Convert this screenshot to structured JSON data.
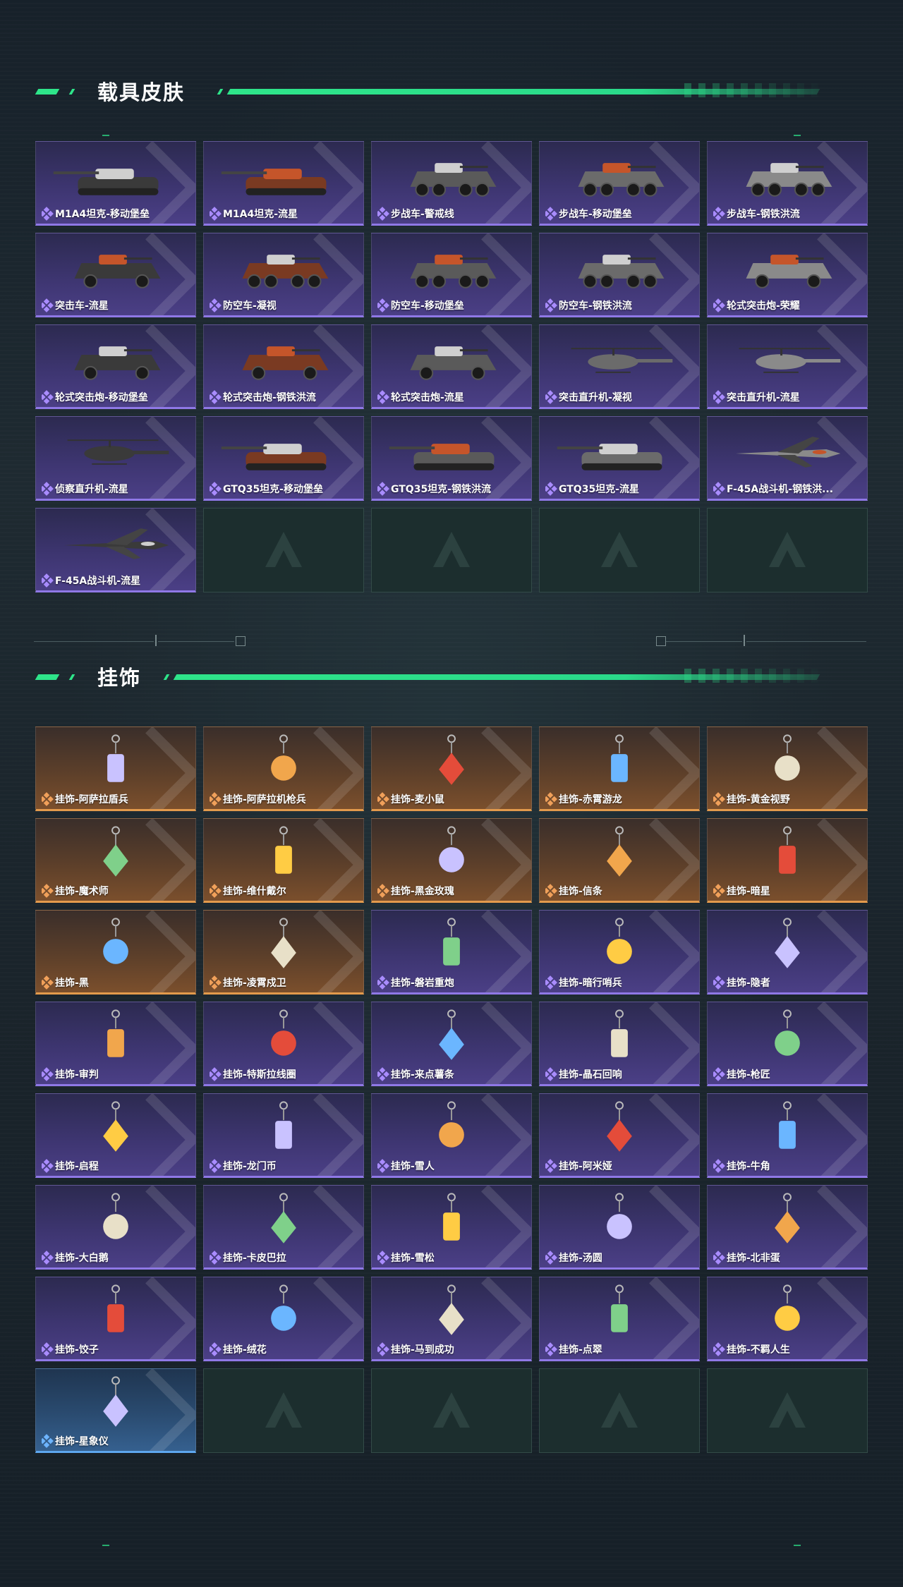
{
  "sections": [
    {
      "title": "载具皮肤"
    },
    {
      "title": "挂饰"
    }
  ],
  "colors": {
    "accent": "#2ee58a",
    "purple": "#8f78e6",
    "orange": "#e39a4c",
    "blue": "#5ea8f0"
  },
  "vehicles": [
    {
      "name": "M1A4坦克-移动堡垒",
      "rarity": "purple",
      "kind": "tank-icon"
    },
    {
      "name": "M1A4坦克-流星",
      "rarity": "purple",
      "kind": "tank-icon"
    },
    {
      "name": "步战车-警戒线",
      "rarity": "purple",
      "kind": "ifv-icon"
    },
    {
      "name": "步战车-移动堡垒",
      "rarity": "purple",
      "kind": "ifv-icon"
    },
    {
      "name": "步战车-钢铁洪流",
      "rarity": "purple",
      "kind": "ifv-icon"
    },
    {
      "name": "突击车-流星",
      "rarity": "purple",
      "kind": "assault-vehicle-icon"
    },
    {
      "name": "防空车-凝视",
      "rarity": "purple",
      "kind": "ifv-icon"
    },
    {
      "name": "防空车-移动堡垒",
      "rarity": "purple",
      "kind": "ifv-icon"
    },
    {
      "name": "防空车-钢铁洪流",
      "rarity": "purple",
      "kind": "ifv-icon"
    },
    {
      "name": "轮式突击炮-荣耀",
      "rarity": "purple",
      "kind": "wheeled-gun-icon"
    },
    {
      "name": "轮式突击炮-移动堡垒",
      "rarity": "purple",
      "kind": "wheeled-gun-icon"
    },
    {
      "name": "轮式突击炮-钢铁洪流",
      "rarity": "purple",
      "kind": "wheeled-gun-icon"
    },
    {
      "name": "轮式突击炮-流星",
      "rarity": "purple",
      "kind": "wheeled-gun-icon"
    },
    {
      "name": "突击直升机-凝视",
      "rarity": "purple",
      "kind": "helicopter-icon"
    },
    {
      "name": "突击直升机-流星",
      "rarity": "purple",
      "kind": "helicopter-icon"
    },
    {
      "name": "侦察直升机-流星",
      "rarity": "purple",
      "kind": "helicopter-icon"
    },
    {
      "name": "GTQ35坦克-移动堡垒",
      "rarity": "purple",
      "kind": "tank-icon"
    },
    {
      "name": "GTQ35坦克-钢铁洪流",
      "rarity": "purple",
      "kind": "tank-icon"
    },
    {
      "name": "GTQ35坦克-流星",
      "rarity": "purple",
      "kind": "tank-icon"
    },
    {
      "name": "F-45A战斗机-钢铁洪...",
      "rarity": "purple",
      "kind": "jet-icon"
    },
    {
      "name": "F-45A战斗机-流星",
      "rarity": "purple",
      "kind": "jet-icon"
    }
  ],
  "charms": [
    {
      "name": "挂饰-阿萨拉盾兵",
      "rarity": "orange"
    },
    {
      "name": "挂饰-阿萨拉机枪兵",
      "rarity": "orange"
    },
    {
      "name": "挂饰-麦小鼠",
      "rarity": "orange"
    },
    {
      "name": "挂饰-赤霄游龙",
      "rarity": "orange"
    },
    {
      "name": "挂饰-黄金视野",
      "rarity": "orange"
    },
    {
      "name": "挂饰-魔术师",
      "rarity": "orange"
    },
    {
      "name": "挂饰-维什戴尔",
      "rarity": "orange"
    },
    {
      "name": "挂饰-黑金玫瑰",
      "rarity": "orange"
    },
    {
      "name": "挂饰-信条",
      "rarity": "orange"
    },
    {
      "name": "挂饰-暗星",
      "rarity": "orange"
    },
    {
      "name": "挂饰-黑",
      "rarity": "orange"
    },
    {
      "name": "挂饰-凌霄戍卫",
      "rarity": "orange"
    },
    {
      "name": "挂饰-磐岩重炮",
      "rarity": "purple"
    },
    {
      "name": "挂饰-暗行哨兵",
      "rarity": "purple"
    },
    {
      "name": "挂饰-隐者",
      "rarity": "purple"
    },
    {
      "name": "挂饰-审判",
      "rarity": "purple"
    },
    {
      "name": "挂饰-特斯拉线圈",
      "rarity": "purple"
    },
    {
      "name": "挂饰-来点薯条",
      "rarity": "purple"
    },
    {
      "name": "挂饰-晶石回响",
      "rarity": "purple"
    },
    {
      "name": "挂饰-枪匠",
      "rarity": "purple"
    },
    {
      "name": "挂饰-启程",
      "rarity": "purple"
    },
    {
      "name": "挂饰-龙门币",
      "rarity": "purple"
    },
    {
      "name": "挂饰-雪人",
      "rarity": "purple"
    },
    {
      "name": "挂饰-阿米娅",
      "rarity": "purple"
    },
    {
      "name": "挂饰-牛角",
      "rarity": "purple"
    },
    {
      "name": "挂饰-大白鹅",
      "rarity": "purple"
    },
    {
      "name": "挂饰-卡皮巴拉",
      "rarity": "purple"
    },
    {
      "name": "挂饰-雪松",
      "rarity": "purple"
    },
    {
      "name": "挂饰-汤圆",
      "rarity": "purple"
    },
    {
      "name": "挂饰-北非蛋",
      "rarity": "purple"
    },
    {
      "name": "挂饰-饺子",
      "rarity": "purple"
    },
    {
      "name": "挂饰-绒花",
      "rarity": "purple"
    },
    {
      "name": "挂饰-马到成功",
      "rarity": "purple"
    },
    {
      "name": "挂饰-点翠",
      "rarity": "purple"
    },
    {
      "name": "挂饰-不羁人生",
      "rarity": "purple"
    },
    {
      "name": "挂饰-星象仪",
      "rarity": "blue"
    }
  ]
}
